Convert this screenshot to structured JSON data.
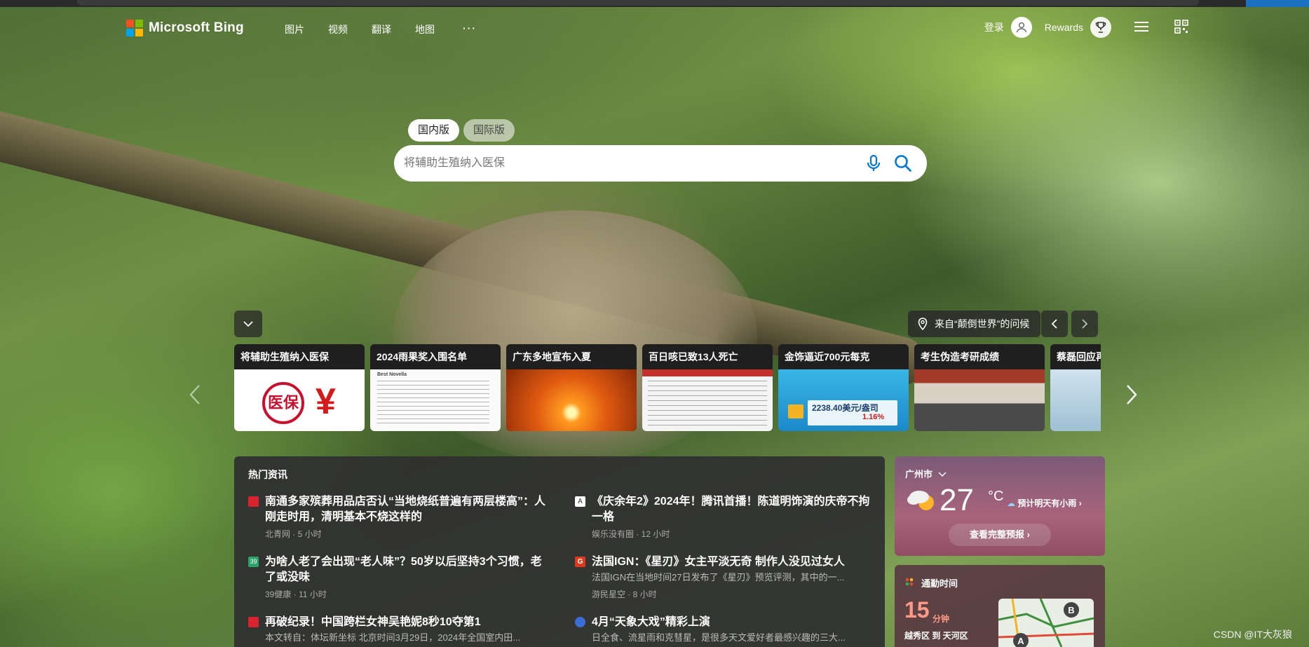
{
  "header": {
    "brand": "Microsoft Bing",
    "nav": [
      "图片",
      "视频",
      "翻译",
      "地图"
    ],
    "more": "···",
    "login": "登录",
    "rewards": "Rewards"
  },
  "search": {
    "tabs": [
      "国内版",
      "国际版"
    ],
    "placeholder": "将辅助生殖纳入医保"
  },
  "carousel": {
    "location_label": "来自“颠倒世界”的问候",
    "cards": [
      {
        "title": "将辅助生殖纳入医保",
        "image_text": "医保"
      },
      {
        "title": "2024雨果奖入围名单",
        "image_text": "Best Novella"
      },
      {
        "title": "广东多地宣布入夏"
      },
      {
        "title": "百日咳已致13人死亡"
      },
      {
        "title": "金饰逼近700元每克",
        "image_text": "2238.40美元/盎司",
        "image_pct": "1.16%"
      },
      {
        "title": "考生伪造考研成绩"
      },
      {
        "title": "蔡磊回应再"
      }
    ]
  },
  "news": {
    "heading": "热门资讯",
    "items": [
      {
        "title": "南通多家殡葬用品店否认“当地烧纸普遍有两层楼高”：人刚走时用，清明基本不烧这样的",
        "desc": "",
        "meta": "北青网 · 5 小时",
        "icon_color": "#d9232e"
      },
      {
        "title": "《庆余年2》2024年！腾讯首播！陈道明饰演的庆帝不拘一格",
        "desc": "",
        "meta": "娱乐没有圈 · 12 小时",
        "icon_color": "#ffffff"
      },
      {
        "title": "为啥人老了会出现“老人味”？50岁以后坚持3个习惯，老了或没味",
        "desc": "",
        "meta": "39健康 · 11 小时",
        "icon_color": "#2aa36b"
      },
      {
        "title": "法国IGN：《星刃》女主平淡无奇 制作人没见过女人",
        "desc": "法国IGN在当地时间27日发布了《星刃》预览评测，其中的一...",
        "meta": "游民星空 · 8 小时",
        "icon_color": "#e03a1e"
      },
      {
        "title": "再破纪录！中国跨栏女神吴艳妮8秒10夺第1",
        "desc": "本文转自：体坛新坐标 北京时间3月29日，2024年全国室内田...",
        "meta": "",
        "icon_color": "#d9232e"
      },
      {
        "title": "4月“天象大戏”精彩上演",
        "desc": "日全食、流星雨和克彗星，是很多天文爱好者最感兴趣的三大...",
        "meta": "",
        "icon_color": "#3b6fd6"
      }
    ]
  },
  "weather": {
    "city": "广州市",
    "temp": "27",
    "unit": "°C",
    "forecast": "预计明天有小雨",
    "full_forecast": "查看完整预报"
  },
  "commute": {
    "heading": "通勤时间",
    "minutes": "15",
    "unit": "分钟",
    "route": "越秀区 到 天河区"
  },
  "watermark": "CSDN @IT大灰狼",
  "colors": {
    "ms_red": "#f25022",
    "ms_green": "#7fba00",
    "ms_blue": "#00a4ef",
    "ms_yellow": "#ffb900",
    "search_blue": "#0078d4"
  }
}
